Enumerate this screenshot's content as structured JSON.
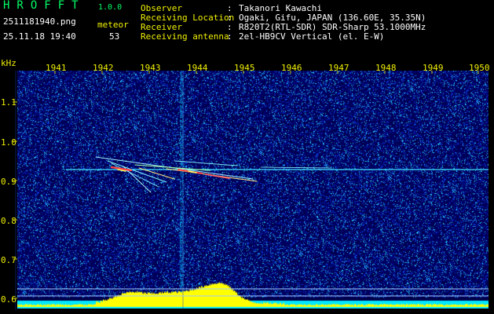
{
  "header": {
    "app_title": "HROFFT",
    "version": "1.0.0",
    "filename": "2511181940.png",
    "datetime": "25.11.18 19:40",
    "meteor_label": "meteor",
    "meteor_count": "53",
    "info": [
      {
        "key": "Observer",
        "value": "Takanori Kawachi"
      },
      {
        "key": "Receiving Location",
        "value": "Ogaki, Gifu, JAPAN (136.60E, 35.35N)"
      },
      {
        "key": "Receiver",
        "value": "R820T2(RTL-SDR) SDR-Sharp 53.1000MHz"
      },
      {
        "key": "Receiving antenna",
        "value": "2el-HB9CV Vertical (el. E-W)"
      }
    ],
    "colon": ":"
  },
  "axes": {
    "y_unit": "kHz",
    "y_ticks": [
      "1.1",
      "1.0",
      "0.9",
      "0.8",
      "0.7",
      "0.6"
    ],
    "x_ticks": [
      "1941",
      "1942",
      "1943",
      "1944",
      "1945",
      "1946",
      "1947",
      "1948",
      "1949",
      "1950"
    ]
  },
  "colors": {
    "label_green": "#00ff66",
    "label_yellow": "#f0f000",
    "background_noise": "#00004a",
    "carrier_line": "#40e0ff",
    "echo_hot": "#ff4040",
    "spectrum_bars": "#ffff00",
    "spectrum_base": "#00e8ff"
  }
}
